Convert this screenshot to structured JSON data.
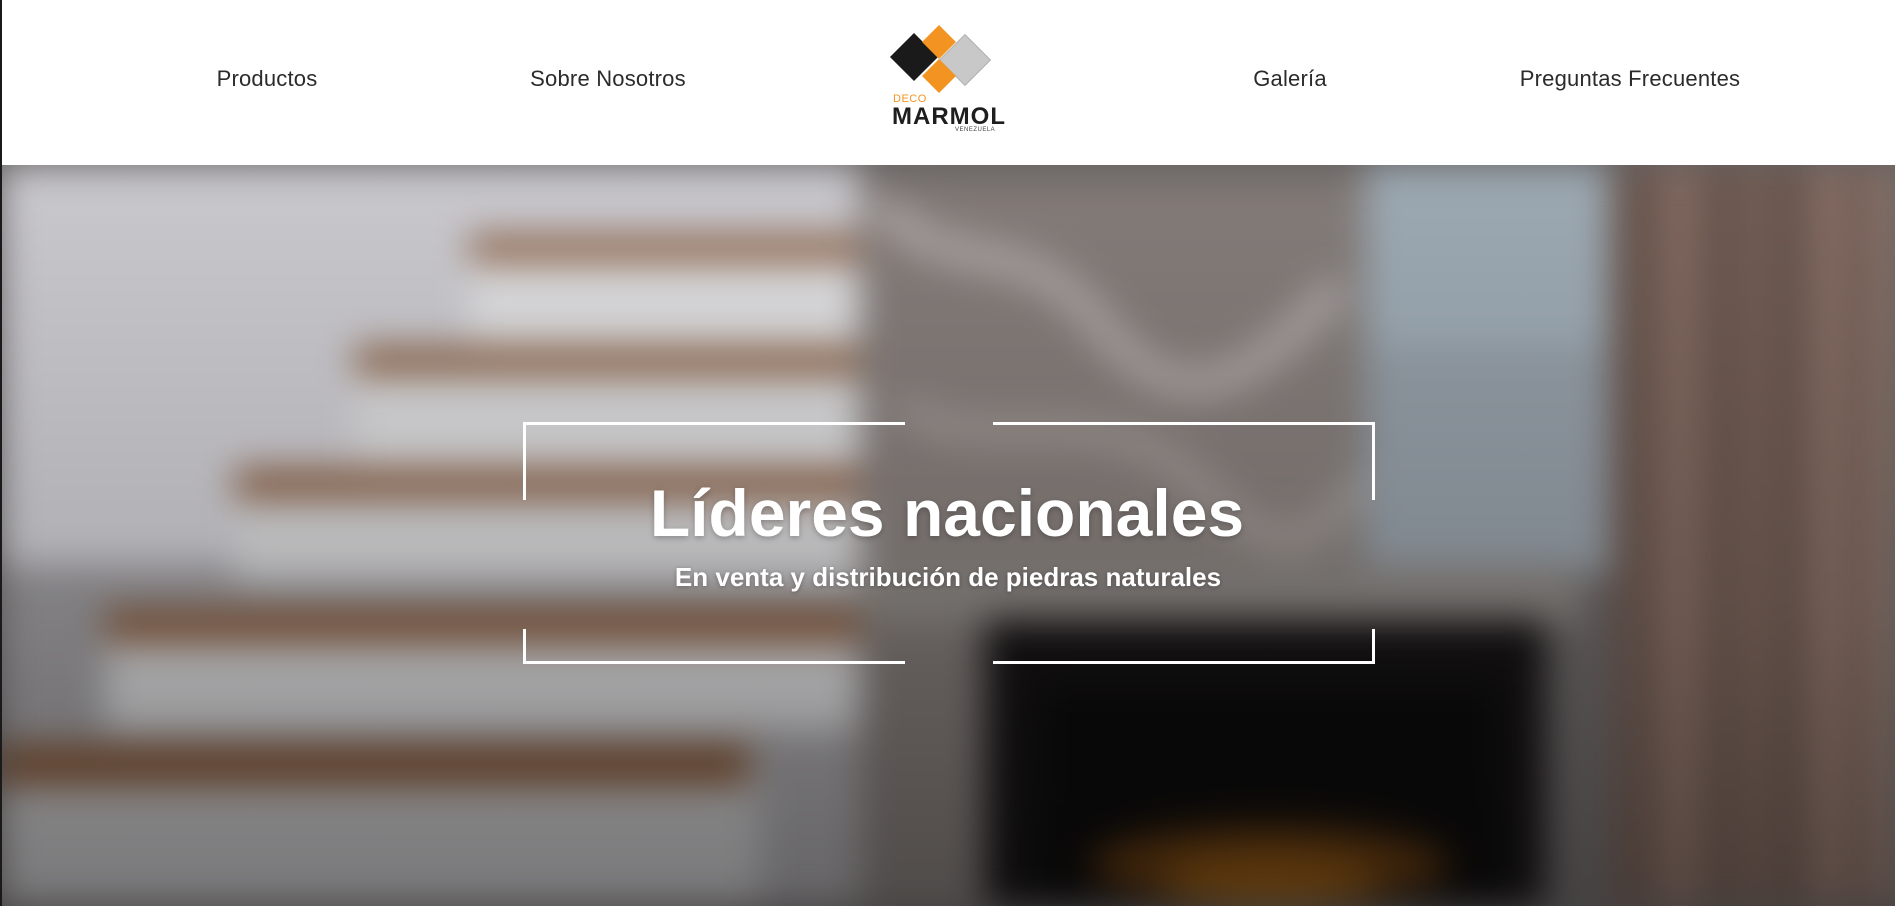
{
  "nav": {
    "productos": "Productos",
    "sobre_nosotros": "Sobre Nosotros",
    "galeria": "Galería",
    "preguntas": "Preguntas Frecuentes"
  },
  "logo": {
    "deco": "DECO",
    "marmol": "MARMOL",
    "venezuela": "VENEZUELA",
    "colors": {
      "black": "#1a1a1a",
      "orange": "#f39321",
      "gray": "#c8c8c8"
    }
  },
  "hero": {
    "title": "Líderes nacionales",
    "subtitle": "En venta y distribución de piedras naturales",
    "frame_color": "#ffffff"
  }
}
